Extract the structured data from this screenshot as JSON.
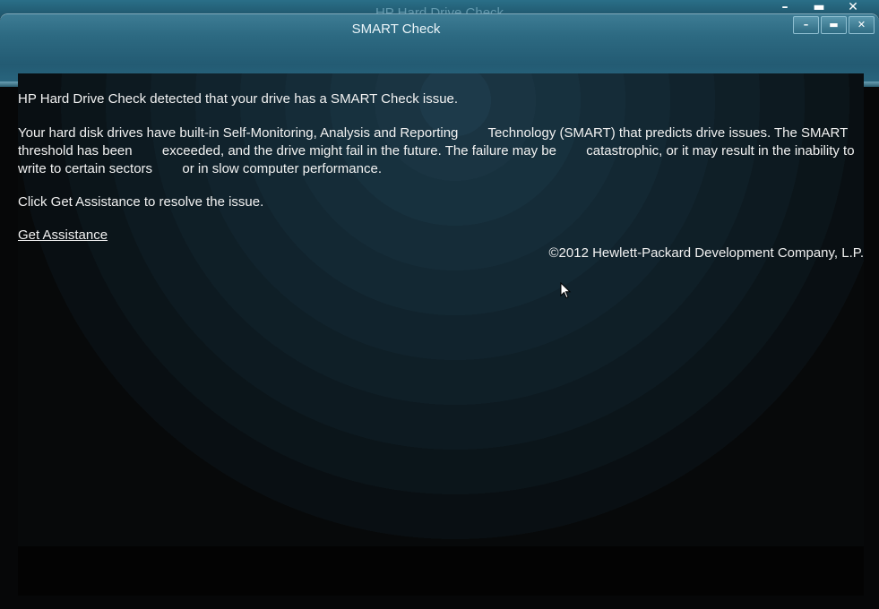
{
  "background_window": {
    "title": "HP Hard Drive Check",
    "controls": [
      "–",
      "▬",
      "✕"
    ]
  },
  "dialog": {
    "title": "SMART Check",
    "controls": {
      "minimize": "–",
      "maximize": "▬",
      "close": "✕"
    },
    "message_line1": "HP Hard Drive Check detected that your drive has a SMART Check issue.",
    "message_line2": "Your hard disk drives have built-in Self-Monitoring, Analysis and Reporting        Technology (SMART) that predicts drive issues. The SMART threshold has been        exceeded, and the drive might fail in the future. The failure may be        catastrophic, or it may result in the inability to write to certain sectors        or in slow computer performance.",
    "message_line3": "Click Get Assistance to resolve the issue.",
    "link_label": "Get Assistance",
    "copyright": "©2012 Hewlett-Packard Development Company, L.P."
  },
  "colors": {
    "titlebar": "#2d6a82",
    "background": "#060708",
    "text": "#f2f2f2"
  }
}
